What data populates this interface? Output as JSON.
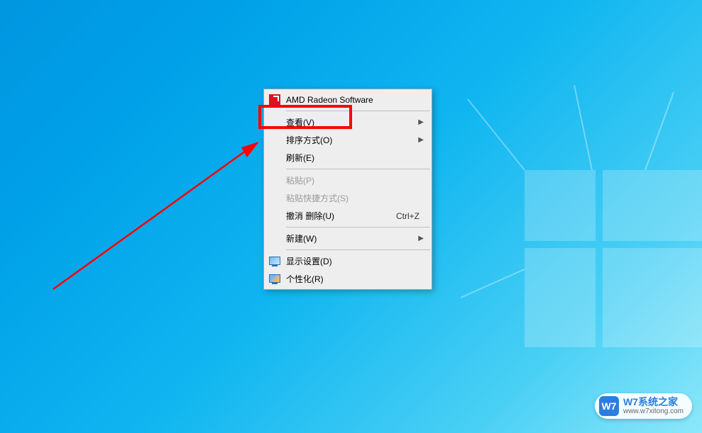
{
  "contextMenu": {
    "amd": {
      "label": "AMD Radeon Software"
    },
    "view": {
      "label": "查看(V)"
    },
    "sort": {
      "label": "排序方式(O)"
    },
    "refresh": {
      "label": "刷新(E)"
    },
    "paste": {
      "label": "粘贴(P)"
    },
    "pasteShortcut": {
      "label": "粘贴快捷方式(S)"
    },
    "undo": {
      "label": "撤消 删除(U)",
      "shortcut": "Ctrl+Z"
    },
    "new": {
      "label": "新建(W)"
    },
    "display": {
      "label": "显示设置(D)"
    },
    "personalize": {
      "label": "个性化(R)"
    }
  },
  "annotation": {
    "highlightedItem": "view"
  },
  "watermark": {
    "badge": "W7",
    "title": "W7系统之家",
    "url": "www.w7xitong.com"
  }
}
